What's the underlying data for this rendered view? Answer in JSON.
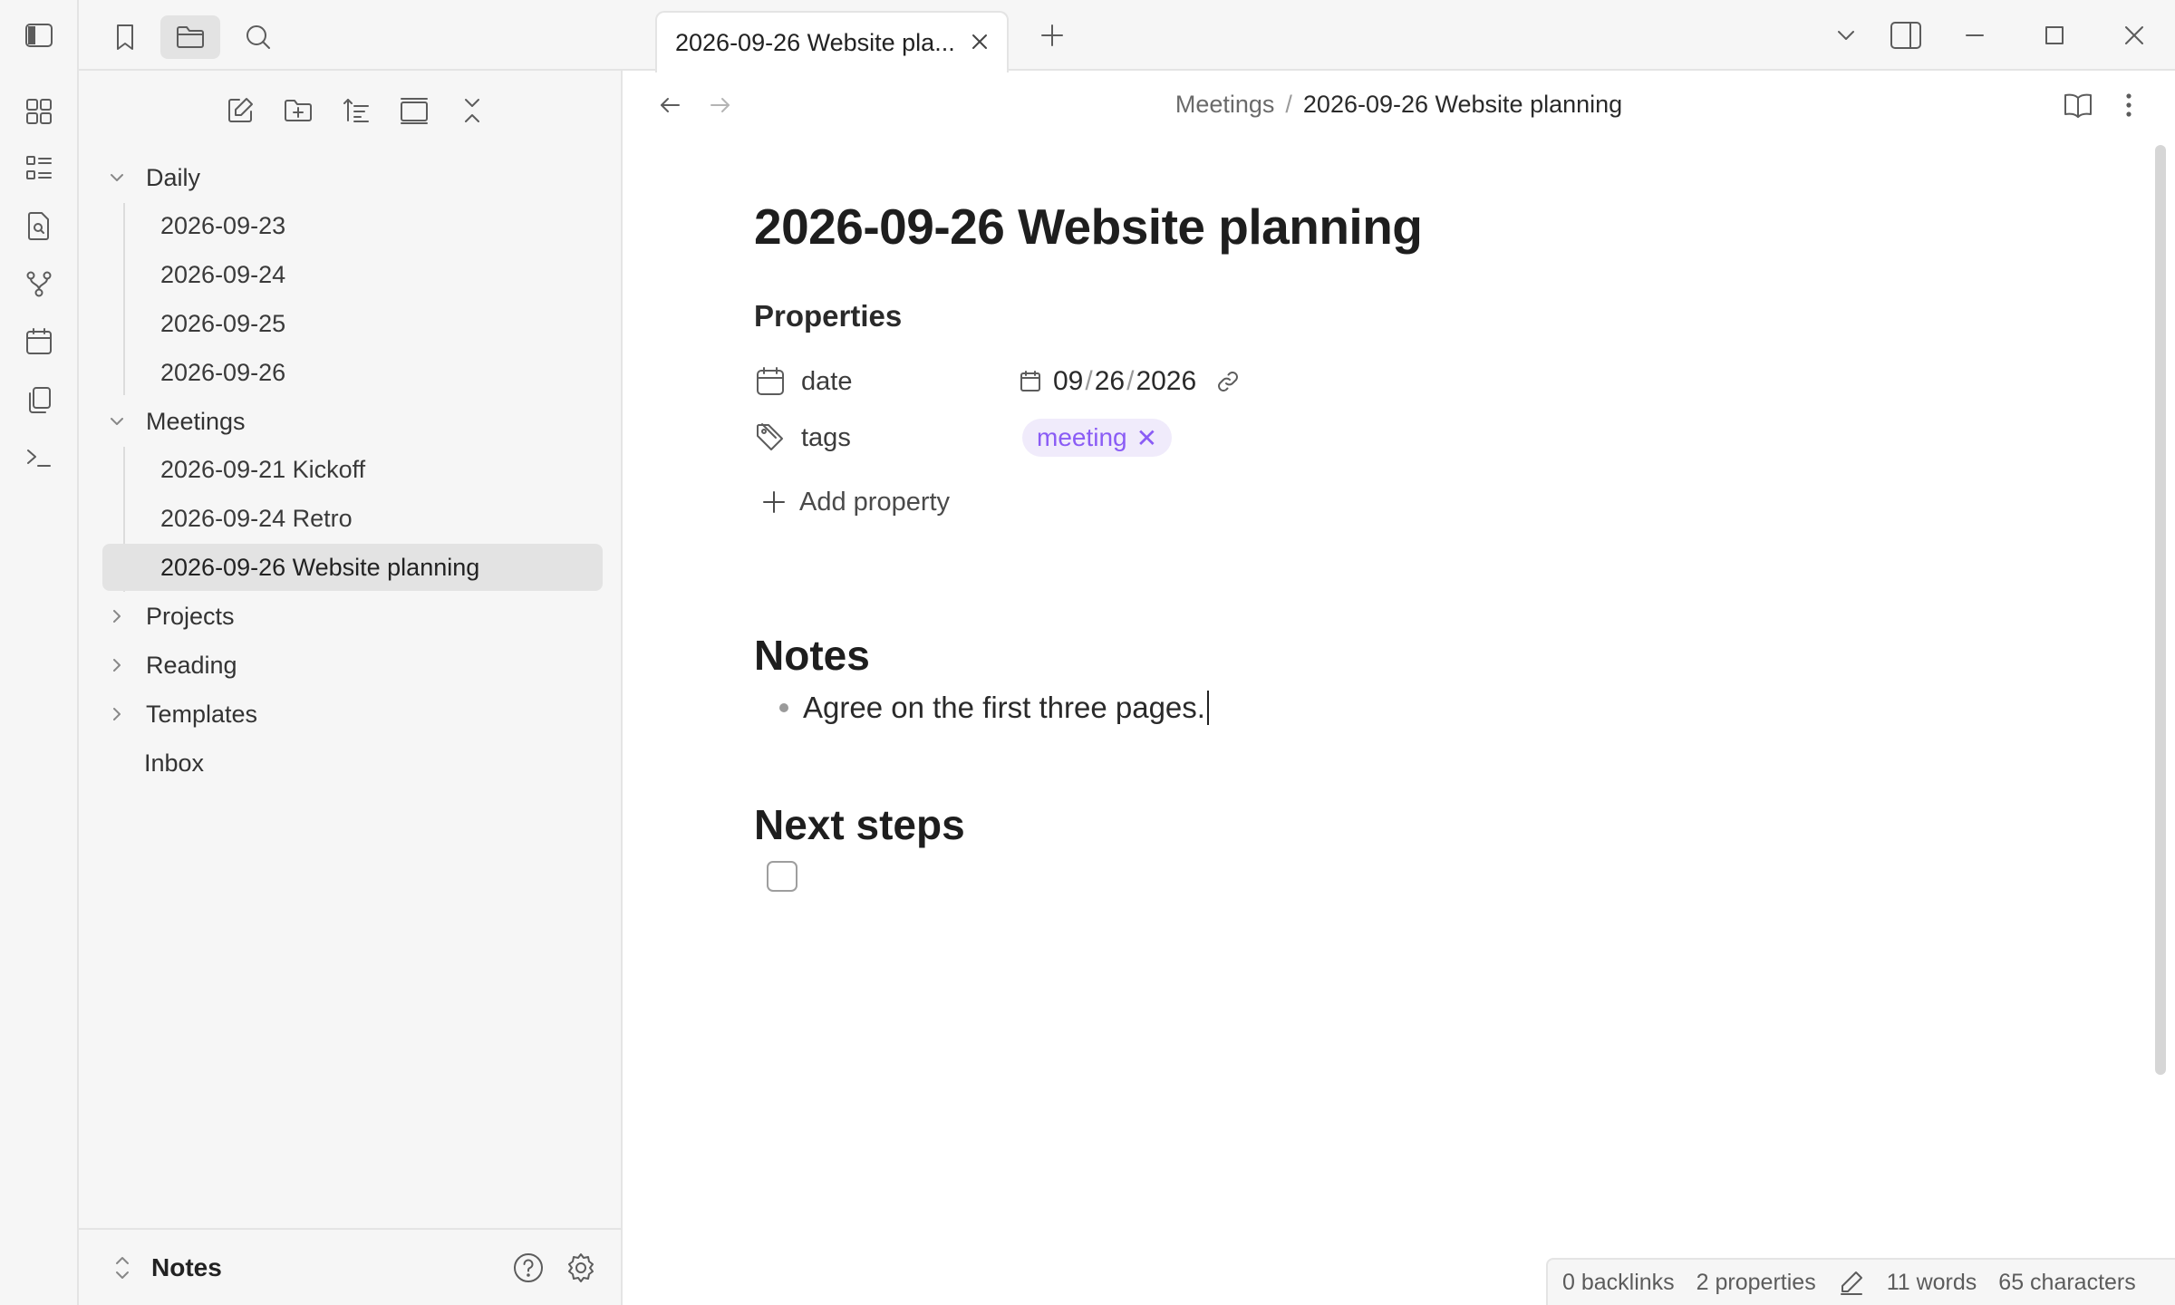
{
  "ribbon": {
    "icons": [
      "sidebar-toggle-icon",
      "canvas-icon",
      "outline-icon",
      "search-file-icon",
      "graph-icon",
      "calendar-icon",
      "copy-icon",
      "terminal-icon"
    ]
  },
  "sidebar_tabs": [
    "bookmark-icon",
    "folder-icon",
    "search-icon"
  ],
  "nav_actions": [
    "new-note-icon",
    "new-folder-icon",
    "sort-icon",
    "collapse-view-icon",
    "collapse-all-icon"
  ],
  "tree": {
    "daily": {
      "label": "Daily",
      "files": [
        "2026-09-23",
        "2026-09-24",
        "2026-09-25",
        "2026-09-26"
      ]
    },
    "meetings": {
      "label": "Meetings",
      "files": [
        "2026-09-21 Kickoff",
        "2026-09-24 Retro",
        "2026-09-26 Website planning"
      ]
    },
    "projects": "Projects",
    "reading": "Reading",
    "templates": "Templates",
    "inbox": "Inbox"
  },
  "vault": {
    "name": "Notes"
  },
  "tab": {
    "title": "2026-09-26 Website pla..."
  },
  "breadcrumb": {
    "parent": "Meetings",
    "separator": "/",
    "current": "2026-09-26 Website planning"
  },
  "note": {
    "title": "2026-09-26 Website planning",
    "properties_heading": "Properties",
    "date": {
      "key": "date",
      "month": "09",
      "day": "26",
      "year": "2026",
      "sep": "/"
    },
    "tags": {
      "key": "tags",
      "value": "meeting",
      "remove": "✕"
    },
    "add_property": "Add property",
    "notes_heading": "Notes",
    "bullet": "Agree on the first three pages.",
    "next_steps_heading": "Next steps"
  },
  "status": {
    "backlinks": "0 backlinks",
    "properties": "2 properties",
    "words": "11 words",
    "characters": "65 characters"
  },
  "colors": {
    "accent": "#8a5cf5",
    "tag_bg": "#f0ebfb",
    "sidebar_bg": "#f6f6f6"
  }
}
